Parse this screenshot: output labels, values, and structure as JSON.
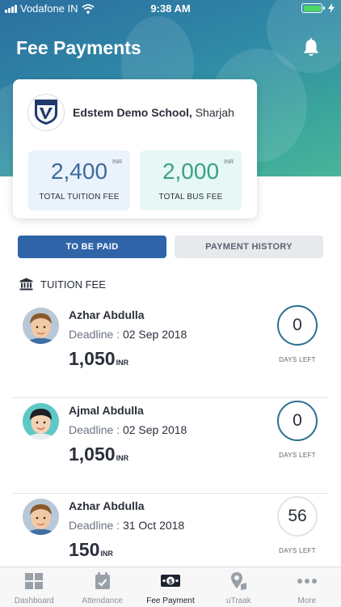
{
  "status_bar": {
    "carrier": "Vodafone IN",
    "time": "9:38 AM"
  },
  "header": {
    "title": "Fee Payments",
    "bell_icon": "bell-icon"
  },
  "school": {
    "name": "Edstem Demo School,",
    "city": " Sharjah"
  },
  "fees": [
    {
      "amount": "2,400",
      "currency": "INR",
      "label": "TOTAL TUITION FEE"
    },
    {
      "amount": "2,000",
      "currency": "INR",
      "label": "TOTAL BUS FEE"
    }
  ],
  "tabs": {
    "to_be_paid": "TO BE PAID",
    "history": "PAYMENT HISTORY"
  },
  "section": {
    "title": "TUITION FEE",
    "icon": "bank-icon"
  },
  "deadline_label": "Deadline : ",
  "days_left_label": "DAYS LEFT",
  "items": [
    {
      "name": "Azhar Abdulla",
      "deadline": "02 Sep 2018",
      "amount": "1,050",
      "currency": "INR",
      "days": "0"
    },
    {
      "name": "Ajmal Abdulla",
      "deadline": "02 Sep 2018",
      "amount": "1,050",
      "currency": "INR",
      "days": "0"
    },
    {
      "name": "Azhar Abdulla",
      "deadline": "31 Oct 2018",
      "amount": "150",
      "currency": "INR",
      "days": "56"
    }
  ],
  "bottom_nav": [
    {
      "label": "Dashboard",
      "icon": "dashboard-icon"
    },
    {
      "label": "Attendance",
      "icon": "calendar-check-icon"
    },
    {
      "label": "Fee Payment",
      "icon": "money-icon"
    },
    {
      "label": "uTraak",
      "icon": "map-pin-icon"
    },
    {
      "label": "More",
      "icon": "more-icon"
    }
  ],
  "colors": {
    "primary": "#2f65a8",
    "teal": "#3a9e8a",
    "ring": "#2c6f8f"
  }
}
